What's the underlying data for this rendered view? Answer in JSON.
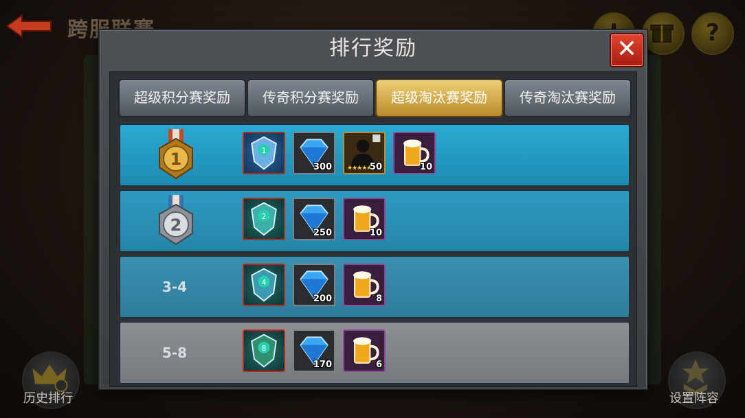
{
  "background": {
    "title": "跨服联赛",
    "help_glyph": "?",
    "history_label": "历史排行",
    "lineup_label": "设置阵容"
  },
  "modal": {
    "title": "排行奖励",
    "close_glyph": "✕"
  },
  "tabs": [
    {
      "label": "超级积分赛奖励",
      "active": false
    },
    {
      "label": "传奇积分赛奖励",
      "active": false
    },
    {
      "label": "超级淘汰赛奖励",
      "active": true
    },
    {
      "label": "传奇淘汰赛奖励",
      "active": false
    }
  ],
  "rows": [
    {
      "rank": "1",
      "medal": "gold-medal-icon",
      "items": [
        {
          "icon": "blue-shield-badge-icon",
          "badge": "1",
          "quantity": ""
        },
        {
          "icon": "diamond-icon",
          "quantity": "300"
        },
        {
          "icon": "hero-silhouette-card-icon",
          "quantity": "50",
          "stars": "★★★★★"
        },
        {
          "icon": "beer-mug-icon",
          "quantity": "10"
        }
      ]
    },
    {
      "rank": "2",
      "medal": "silver-medal-icon",
      "items": [
        {
          "icon": "teal-shield-badge-icon",
          "badge": "2",
          "quantity": ""
        },
        {
          "icon": "diamond-icon",
          "quantity": "250"
        },
        {
          "icon": "beer-mug-icon",
          "quantity": "10"
        }
      ]
    },
    {
      "rank": "3-4",
      "items": [
        {
          "icon": "teal-shield-badge-icon",
          "badge": "4",
          "quantity": ""
        },
        {
          "icon": "diamond-icon",
          "quantity": "200"
        },
        {
          "icon": "beer-mug-icon",
          "quantity": "8"
        }
      ]
    },
    {
      "rank": "5-8",
      "items": [
        {
          "icon": "green-shield-badge-icon",
          "badge": "8",
          "quantity": ""
        },
        {
          "icon": "diamond-icon",
          "quantity": "170"
        },
        {
          "icon": "beer-mug-icon",
          "quantity": "6"
        }
      ]
    }
  ]
}
